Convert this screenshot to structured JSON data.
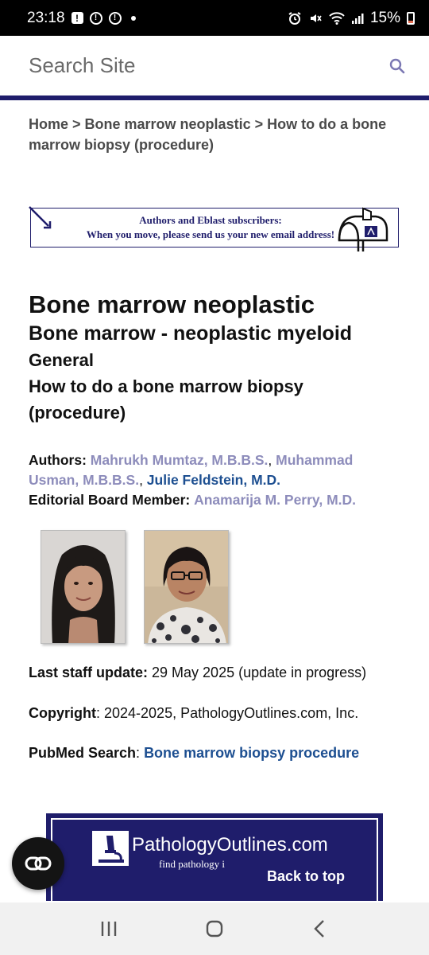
{
  "status_bar": {
    "time": "23:18",
    "battery": "15%",
    "icons": [
      "alert-box-icon",
      "alert-circle-icon",
      "alert-circle-icon",
      "dot-icon",
      "alarm-icon",
      "mute-icon",
      "wifi-icon",
      "signal-icon",
      "battery-icon"
    ]
  },
  "search": {
    "placeholder": "Search Site",
    "icon": "search-icon"
  },
  "breadcrumb": {
    "home": "Home",
    "sep1": " > ",
    "section": "Bone marrow neoplastic",
    "sep2": " > ",
    "current": "How to do a bone marrow biopsy (procedure)"
  },
  "banner": {
    "line1": "Authors and Eblast subscribers:",
    "line2": "When you move, please send us your new email address!"
  },
  "titles": {
    "chapter": "Bone marrow neoplastic",
    "subchapter": "Bone marrow - neoplastic myeloid",
    "section": "General",
    "topic": "How to do a bone marrow biopsy (procedure)"
  },
  "authors": {
    "label": "Authors:",
    "author1": "Mahrukh Mumtaz, M.B.B.S.",
    "author2": "Muhammad Usman, M.B.B.S.",
    "author3": "Julie Feldstein, M.D.",
    "comma": ", ",
    "editor_label": "Editorial Board Member:",
    "editor": "Anamarija M. Perry, M.D."
  },
  "updates": {
    "label": "Last staff update:",
    "value": " 29 May 2025 (update in progress)"
  },
  "copyright": {
    "label": "Copyright",
    "value": ": 2024-2025, PathologyOutlines.com, Inc."
  },
  "pubmed": {
    "label": "PubMed Search",
    "sep": ": ",
    "link": "Bone marrow biopsy procedure"
  },
  "ad": {
    "title": "PathologyOutlines.com",
    "tagline": "find pathology i"
  },
  "back_to_top": "Back to top",
  "colors": {
    "brand_navy": "#1f1d6b",
    "link_muted": "#8d8cbb",
    "link_blue": "#1d4f91"
  }
}
